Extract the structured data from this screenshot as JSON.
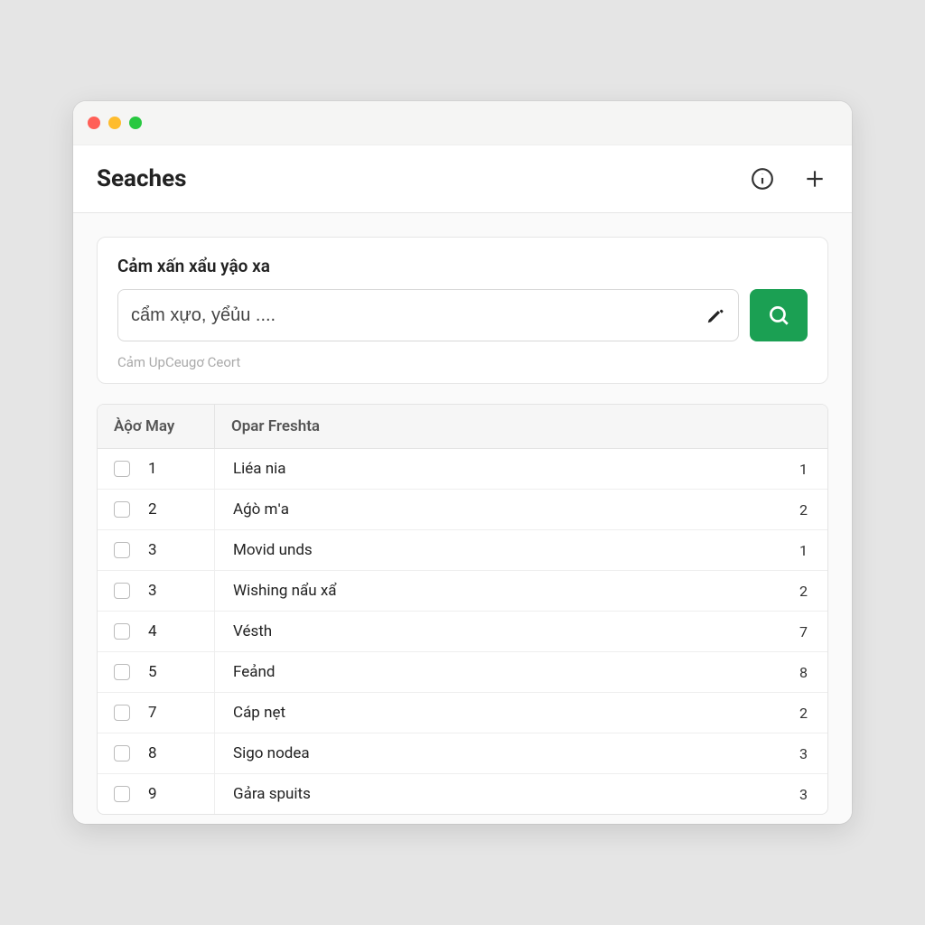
{
  "header": {
    "title": "Seaches"
  },
  "search": {
    "title": "Cảm xấn xẩu yậo xa",
    "placeholder": "cẩm xựo, yểủu ....",
    "hint": "Cảm UpCeugơ Ceort"
  },
  "table": {
    "columns": {
      "may": "Àộơ May",
      "desc": "Opar Freshta"
    },
    "rows": [
      {
        "idx": "1",
        "desc": "Liéa nia",
        "count": "1"
      },
      {
        "idx": "2",
        "desc": "Aǵò mʹa",
        "count": "2"
      },
      {
        "idx": "3",
        "desc": "Movid unds",
        "count": "1"
      },
      {
        "idx": "3",
        "desc": "Wishing nẩu xẩ",
        "count": "2"
      },
      {
        "idx": "4",
        "desc": "Vésth",
        "count": "7"
      },
      {
        "idx": "5",
        "desc": "Feảnd",
        "count": "8"
      },
      {
        "idx": "7",
        "desc": "Cáp nẹt",
        "count": "2"
      },
      {
        "idx": "8",
        "desc": "Sigo nodea",
        "count": "3"
      },
      {
        "idx": "9",
        "desc": "Gảra spuits",
        "count": "3"
      }
    ]
  }
}
